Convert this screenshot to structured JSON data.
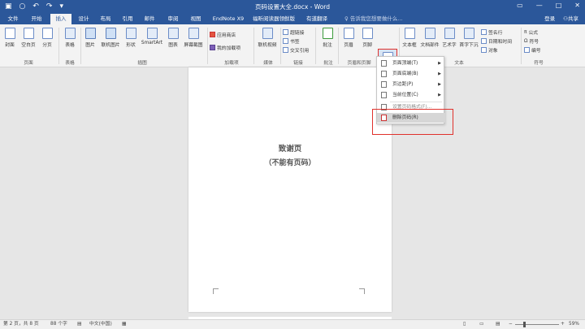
{
  "window": {
    "title": "页码设置大全.docx - Word"
  },
  "tabs": [
    "文件",
    "开始",
    "插入",
    "设计",
    "布局",
    "引用",
    "邮件",
    "审阅",
    "视图",
    "EndNote X9",
    "福昕阅读器领鲜版",
    "有道翻译"
  ],
  "tell_me": "告诉我您想要做什么...",
  "account": {
    "login": "登录",
    "share": "共享"
  },
  "ribbon": {
    "pages": [
      "封面",
      "空白页",
      "分页"
    ],
    "table": "表格",
    "illustrations": [
      "图片",
      "联机图片",
      "形状",
      "SmartArt",
      "图表",
      "屏幕截图"
    ],
    "addins": [
      "应用商店",
      "我的加载项"
    ],
    "media": "联机视频",
    "links": [
      "超链接",
      "书签",
      "交叉引用"
    ],
    "comment": "批注",
    "header_footer": [
      "页眉",
      "页脚",
      "页码"
    ],
    "text": [
      "文本框",
      "文档部件",
      "艺术字",
      "首字下沉"
    ],
    "text_small": [
      "签名行",
      "日期和时间",
      "对象"
    ],
    "symbols": [
      "公式",
      "符号",
      "编号"
    ],
    "groups": [
      "页面",
      "表格",
      "插图",
      "加载项",
      "媒体",
      "链接",
      "批注",
      "页眉和页脚",
      "文本",
      "符号"
    ]
  },
  "dropdown": {
    "items": [
      "页面顶端(T)",
      "页面底端(B)",
      "页边距(P)",
      "当前位置(C)",
      "设置页码格式(F)...",
      "删除页码(R)"
    ]
  },
  "document": {
    "line1": "致谢页",
    "line2": "（不能有页码）"
  },
  "status": {
    "page": "第 2 页，共 8 页",
    "words": "88 个字",
    "language": "中文(中国)",
    "zoom": "59%"
  }
}
